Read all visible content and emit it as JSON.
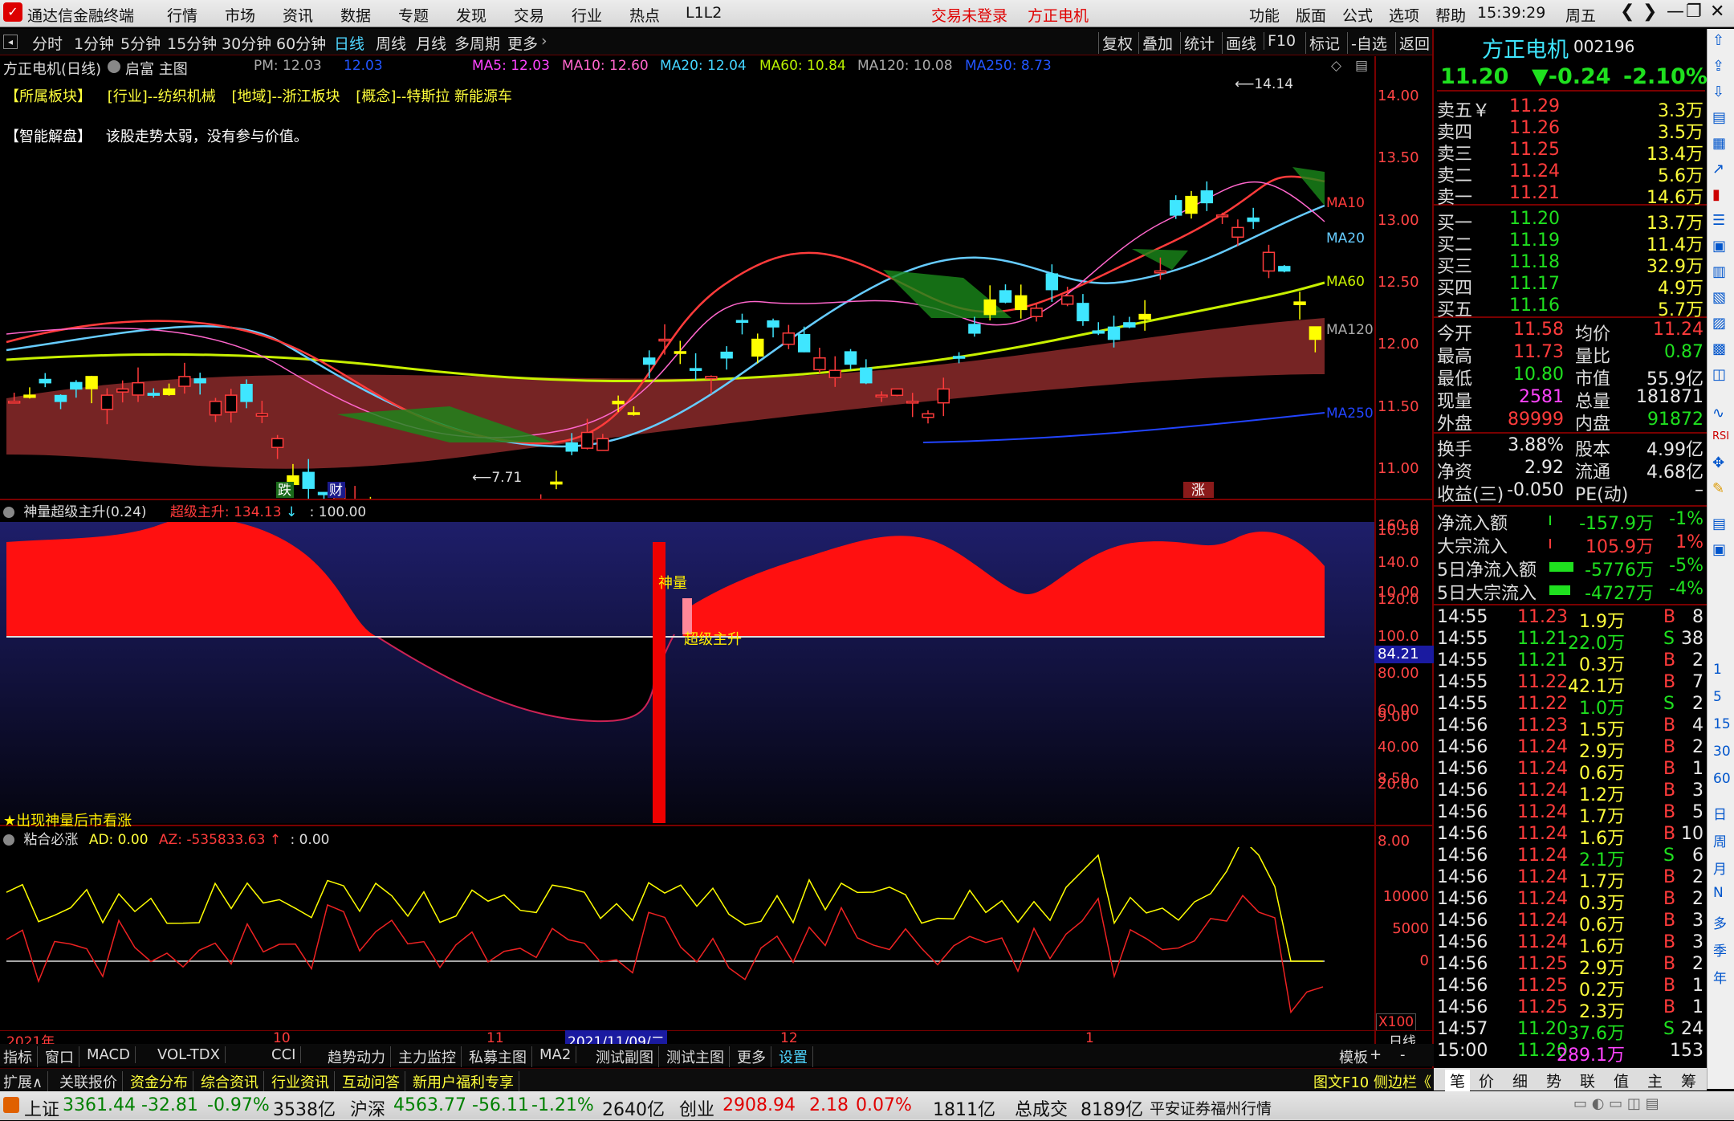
{
  "titlebar": {
    "app_name": "通达信金融终端",
    "menus": [
      "行情",
      "市场",
      "资讯",
      "数据",
      "专题",
      "发现",
      "交易",
      "行业",
      "热点",
      "L1L2"
    ],
    "login_status": "交易未登录",
    "stock_name": "方正电机",
    "right_menus": [
      "功能",
      "版面",
      "公式",
      "选项",
      "帮助"
    ],
    "time": "15:39:29",
    "weekday": "周五"
  },
  "toolbar": {
    "periods": [
      "分时",
      "1分钟",
      "5分钟",
      "15分钟",
      "30分钟",
      "60分钟",
      "日线",
      "周线",
      "月线",
      "多周期",
      "更多"
    ],
    "active_period": "日线",
    "right_buttons": [
      "复权",
      "叠加",
      "统计",
      "画线",
      "F10",
      "标记",
      "-自选",
      "返回"
    ]
  },
  "chart_header": {
    "stock_title": "方正电机(日线)",
    "template": "启富 主图",
    "pm_label": "PM: 12.03",
    "pm_value": "12.03",
    "ma_labels": [
      {
        "text": "MA5: 12.03",
        "color": "#ff44ff"
      },
      {
        "text": "MA10: 12.60",
        "color": "#ff66cc"
      },
      {
        "text": "MA20: 12.04",
        "color": "#44d4ff"
      },
      {
        "text": "MA60: 10.84",
        "color": "#b8f000"
      },
      {
        "text": "MA120: 10.08",
        "color": "#aaaaaa"
      },
      {
        "text": "MA250: 8.73",
        "color": "#2255ff"
      }
    ]
  },
  "sectors": {
    "belong": "【所属板块】",
    "industry": "[行业]--纺织机械",
    "region": "[地域]--浙江板块",
    "concept": "[概念]--特斯拉 新能源车"
  },
  "smart_analysis": {
    "label": "【智能解盘】",
    "text": "该股走势太弱，没有参与价值。"
  },
  "main_chart": {
    "price_axis": [
      "14.00",
      "13.50",
      "13.00",
      "12.50",
      "12.00",
      "11.50",
      "11.00",
      "10.50",
      "10.00",
      "9.50",
      "9.00",
      "8.50",
      "8.00"
    ],
    "high_label": "14.14",
    "low_label": "7.71",
    "ma_end_labels": [
      "MA10",
      "MA20",
      "MA60",
      "MA120",
      "MA250"
    ],
    "markers": [
      "跌",
      "财",
      "涨"
    ]
  },
  "indicator1": {
    "name": "神量超级主升(0.24)",
    "value_label": "超级主升: 134.13",
    "ref_label": ": 100.00",
    "axis": [
      "160.0",
      "140.0",
      "120.0",
      "100.0",
      "80.00",
      "60.00",
      "40.00",
      "20.00"
    ],
    "current_value": "84.21",
    "annot_1": "神量",
    "annot_2": "超级主升",
    "note": "★出现神量后市看涨"
  },
  "indicator2": {
    "name": "粘合必涨",
    "ad_label": "AD: 0.00",
    "az_label": "AZ: -535833.63",
    "ref_label": ": 0.00",
    "axis": [
      "10000",
      "5000",
      "0"
    ],
    "scale": "X100"
  },
  "time_axis": {
    "labels": [
      "2021年",
      "10",
      "11",
      "2021/11/09/二",
      "12",
      "1"
    ],
    "period": "日线"
  },
  "bottom_tabs": [
    "指标",
    "窗口",
    "MACD",
    "VOL-TDX",
    "CCI",
    "趋势动力",
    "主力监控",
    "私募主图",
    "MA2",
    "测试副图",
    "测试主图",
    "更多",
    "设置"
  ],
  "bottom_tabs_right": [
    "模板",
    "+",
    "-"
  ],
  "bottom_tabs2": [
    "扩展∧",
    "关联报价",
    "资金分布",
    "综合资讯",
    "行业资讯",
    "互动问答",
    "新用户福利专享"
  ],
  "bottom_tabs2_right": "图文F10 侧边栏《",
  "rpanel_tabs": [
    "笔",
    "价",
    "细",
    "势",
    "联",
    "值",
    "主",
    "筹"
  ],
  "quote": {
    "name": "方正电机",
    "code": "002196",
    "price": "11.20",
    "change": "▼-0.24",
    "change_pct": "-2.10%",
    "asks": [
      {
        "label": "卖五￥",
        "price": "11.29",
        "vol": "3.3万"
      },
      {
        "label": "卖四",
        "price": "11.26",
        "vol": "3.5万"
      },
      {
        "label": "卖三",
        "price": "11.25",
        "vol": "13.4万"
      },
      {
        "label": "卖二",
        "price": "11.24",
        "vol": "5.6万"
      },
      {
        "label": "卖一",
        "price": "11.21",
        "vol": "14.6万"
      }
    ],
    "bids": [
      {
        "label": "买一",
        "price": "11.20",
        "vol": "13.7万"
      },
      {
        "label": "买二",
        "price": "11.19",
        "vol": "11.4万"
      },
      {
        "label": "买三",
        "price": "11.18",
        "vol": "32.9万"
      },
      {
        "label": "买四",
        "price": "11.17",
        "vol": "4.9万"
      },
      {
        "label": "买五",
        "price": "11.16",
        "vol": "5.7万"
      }
    ],
    "stats": [
      {
        "l1": "今开",
        "v1": "11.58",
        "c1": "red",
        "l2": "均价",
        "v2": "11.24",
        "c2": "red"
      },
      {
        "l1": "最高",
        "v1": "11.73",
        "c1": "red",
        "l2": "量比",
        "v2": "0.87",
        "c2": "grn"
      },
      {
        "l1": "最低",
        "v1": "10.80",
        "c1": "grn",
        "l2": "市值",
        "v2": "55.9亿",
        "c2": "wht"
      },
      {
        "l1": "现量",
        "v1": "2581",
        "c1": "mag",
        "l2": "总量",
        "v2": "181871",
        "c2": "wht"
      },
      {
        "l1": "外盘",
        "v1": "89999",
        "c1": "red",
        "l2": "内盘",
        "v2": "91872",
        "c2": "grn"
      }
    ],
    "stats2": [
      {
        "l1": "换手",
        "v1": "3.88%",
        "l2": "股本",
        "v2": "4.99亿"
      },
      {
        "l1": "净资",
        "v1": "2.92",
        "l2": "流通",
        "v2": "4.68亿"
      },
      {
        "l1": "收益(三)",
        "v1": "-0.050",
        "l2": "PE(动)",
        "v2": "–"
      }
    ],
    "flows": [
      {
        "label": "净流入额",
        "value": "-157.9万",
        "pct": "-1%",
        "color": "grn",
        "bar": 2
      },
      {
        "label": "大宗流入",
        "value": "105.9万",
        "pct": "1%",
        "color": "red",
        "bar": 2
      },
      {
        "label": "5日净流入额",
        "value": "-5776万",
        "pct": "-5%",
        "color": "grn",
        "bar": 30
      },
      {
        "label": "5日大宗流入",
        "value": "-4727万",
        "pct": "-4%",
        "color": "grn",
        "bar": 26
      }
    ],
    "ticks": [
      {
        "t": "14:55",
        "p": "11.23",
        "v": "1.9万",
        "s": "B",
        "n": "8"
      },
      {
        "t": "14:55",
        "p": "11.21",
        "v": "22.0万",
        "s": "S",
        "n": "38"
      },
      {
        "t": "14:55",
        "p": "11.21",
        "v": "0.3万",
        "s": "B",
        "n": "2"
      },
      {
        "t": "14:55",
        "p": "11.22",
        "v": "42.1万",
        "s": "B",
        "n": "7"
      },
      {
        "t": "14:55",
        "p": "11.22",
        "v": "1.0万",
        "s": "S",
        "n": "2"
      },
      {
        "t": "14:56",
        "p": "11.23",
        "v": "1.5万",
        "s": "B",
        "n": "4"
      },
      {
        "t": "14:56",
        "p": "11.24",
        "v": "2.9万",
        "s": "B",
        "n": "2"
      },
      {
        "t": "14:56",
        "p": "11.24",
        "v": "0.6万",
        "s": "B",
        "n": "1"
      },
      {
        "t": "14:56",
        "p": "11.24",
        "v": "1.2万",
        "s": "B",
        "n": "3"
      },
      {
        "t": "14:56",
        "p": "11.24",
        "v": "1.7万",
        "s": "B",
        "n": "5"
      },
      {
        "t": "14:56",
        "p": "11.24",
        "v": "1.6万",
        "s": "B",
        "n": "10"
      },
      {
        "t": "14:56",
        "p": "11.24",
        "v": "2.1万",
        "s": "S",
        "n": "6"
      },
      {
        "t": "14:56",
        "p": "11.24",
        "v": "1.7万",
        "s": "B",
        "n": "2"
      },
      {
        "t": "14:56",
        "p": "11.24",
        "v": "0.3万",
        "s": "B",
        "n": "2"
      },
      {
        "t": "14:56",
        "p": "11.24",
        "v": "0.6万",
        "s": "B",
        "n": "3"
      },
      {
        "t": "14:56",
        "p": "11.24",
        "v": "1.6万",
        "s": "B",
        "n": "3"
      },
      {
        "t": "14:56",
        "p": "11.25",
        "v": "2.9万",
        "s": "B",
        "n": "2"
      },
      {
        "t": "14:56",
        "p": "11.25",
        "v": "0.2万",
        "s": "B",
        "n": "1"
      },
      {
        "t": "14:56",
        "p": "11.25",
        "v": "2.3万",
        "s": "B",
        "n": "1"
      },
      {
        "t": "14:57",
        "p": "11.20",
        "v": "37.6万",
        "s": "S",
        "n": "24"
      },
      {
        "t": "15:00",
        "p": "11.20",
        "v": "289.1万",
        "s": "",
        "n": "153"
      }
    ]
  },
  "rside_icons": [
    "1",
    "5",
    "15",
    "30",
    "60",
    "日",
    "周",
    "月",
    "N",
    "多",
    "季",
    "年"
  ],
  "statusbar": {
    "sh_label": "上证",
    "sh_val": "3361.44",
    "sh_chg": "-32.81",
    "sh_pct": "-0.97%",
    "sh_amt": "3538亿",
    "hs_label": "沪深",
    "hs_val": "4563.77",
    "hs_chg": "-56.11",
    "hs_pct": "-1.21%",
    "hs_amt": "2640亿",
    "cy_label": "创业",
    "cy_val": "2908.94",
    "cy_chg": "2.18",
    "cy_pct": "0.07%",
    "cy_amt": "1811亿",
    "total_label": "总成交",
    "total_val": "8189亿",
    "broker": "平安证券福州行情"
  },
  "colors": {
    "up": "#ff3b3b",
    "down": "#3fe6ff",
    "yang_yellow": "#ffff00",
    "grid": "#7a0000"
  }
}
